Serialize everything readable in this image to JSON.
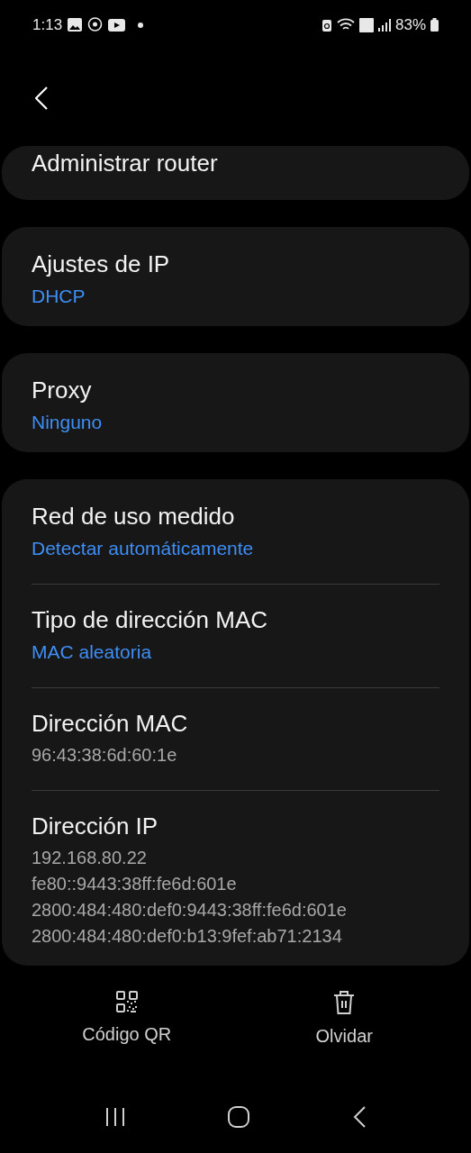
{
  "status_bar": {
    "time": "1:13",
    "battery": "83%"
  },
  "cards": [
    {
      "items": [
        {
          "title": "Administrar router"
        }
      ]
    },
    {
      "items": [
        {
          "title": "Ajustes de IP",
          "kind": "setting",
          "values": [
            "DHCP"
          ]
        }
      ]
    },
    {
      "items": [
        {
          "title": "Proxy",
          "kind": "setting",
          "values": [
            "Ninguno"
          ]
        }
      ]
    },
    {
      "items": [
        {
          "title": "Red de uso medido",
          "kind": "setting",
          "values": [
            "Detectar automáticamente"
          ]
        },
        {
          "title": "Tipo de dirección MAC",
          "kind": "setting",
          "values": [
            "MAC aleatoria"
          ]
        },
        {
          "title": "Dirección MAC",
          "kind": "info",
          "values": [
            "96:43:38:6d:60:1e"
          ]
        },
        {
          "title": "Dirección IP",
          "kind": "info",
          "values": [
            "192.168.80.22",
            "fe80::9443:38ff:fe6d:601e",
            "2800:484:480:def0:9443:38ff:fe6d:601e",
            "2800:484:480:def0:b13:9fef:ab71:2134"
          ]
        }
      ]
    }
  ],
  "actions": [
    {
      "label": "Código QR",
      "kind": "qr"
    },
    {
      "label": "Olvidar",
      "kind": "delete"
    }
  ]
}
